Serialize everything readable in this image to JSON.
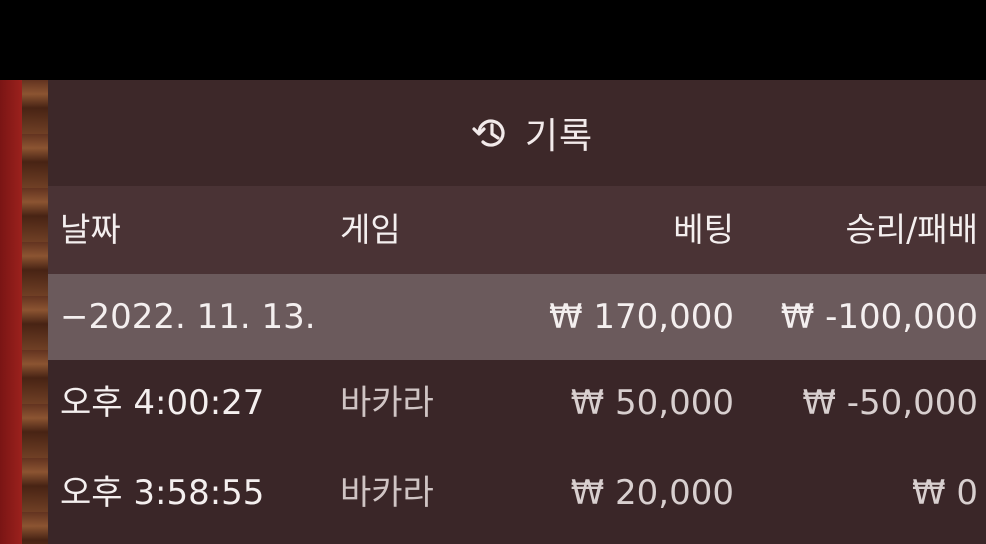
{
  "header": {
    "title": "기록",
    "icon": "history-icon"
  },
  "columns": {
    "date": "날짜",
    "game": "게임",
    "bet": "베팅",
    "win_loss": "승리/패배"
  },
  "summary_row": {
    "date": "−2022. 11. 13.",
    "bet": "₩ 170,000",
    "win_loss": "₩ -100,000"
  },
  "rows": [
    {
      "time": "오후 4:00:27",
      "game": "바카라",
      "bet": "₩ 50,000",
      "win_loss": "₩ -50,000"
    },
    {
      "time": "오후 3:58:55",
      "game": "바카라",
      "bet": "₩ 20,000",
      "win_loss": "₩ 0"
    }
  ],
  "colors": {
    "panel_bg": "#3a2628",
    "column_header_bg": "#4a3335",
    "summary_bg": "#6b5a5c",
    "text": "#f4efef"
  }
}
